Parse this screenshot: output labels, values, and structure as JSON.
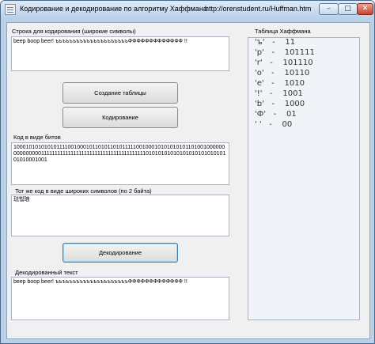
{
  "window": {
    "title": "Кодирование и декодирование по алгоритму Хаффмана",
    "url": "http://orenstudent.ru/Huffman.htm",
    "controls": {
      "minimize": "–",
      "maximize": "□",
      "close": "✕"
    }
  },
  "input_section": {
    "label": "Строка для кодирования (широкие символы)",
    "value": "beep boop beer!        ъъъъъъъъъъъъъъъъъъъъъФФФФФФФФФФФФФ !!"
  },
  "buttons": {
    "create_table": "Создание таблицы",
    "encode": "Кодирование",
    "decode": "Декодирование"
  },
  "bits_section": {
    "label": "Код в виде битов",
    "value": "10001010101010111100100010110101101011111001000101010101011010010000000000000001111111111111111111111111111111111111110101010101010101010101010101010001001"
  },
  "wide_section": {
    "label": "Тот же код в виде широких символов (по 2 байта)",
    "value": "琺쀀琅"
  },
  "decoded_section": {
    "label": "Декодированный текст",
    "value": "beep boop beer!        ъъъъъъъъъъъъъъъъъъъъъФФФФФФФФФФФФФ !!"
  },
  "huffman_table": {
    "label": "Таблица Хаффмана",
    "items": [
      "'ъ'   -    11",
      "'p'   -    101111",
      "'r'   -    101110",
      "'o'   -    10110",
      "'e'   -    1010",
      "'!'   -    1001",
      "'b'   -    1000",
      "'Ф'   -    01",
      "' '   -    00"
    ]
  }
}
